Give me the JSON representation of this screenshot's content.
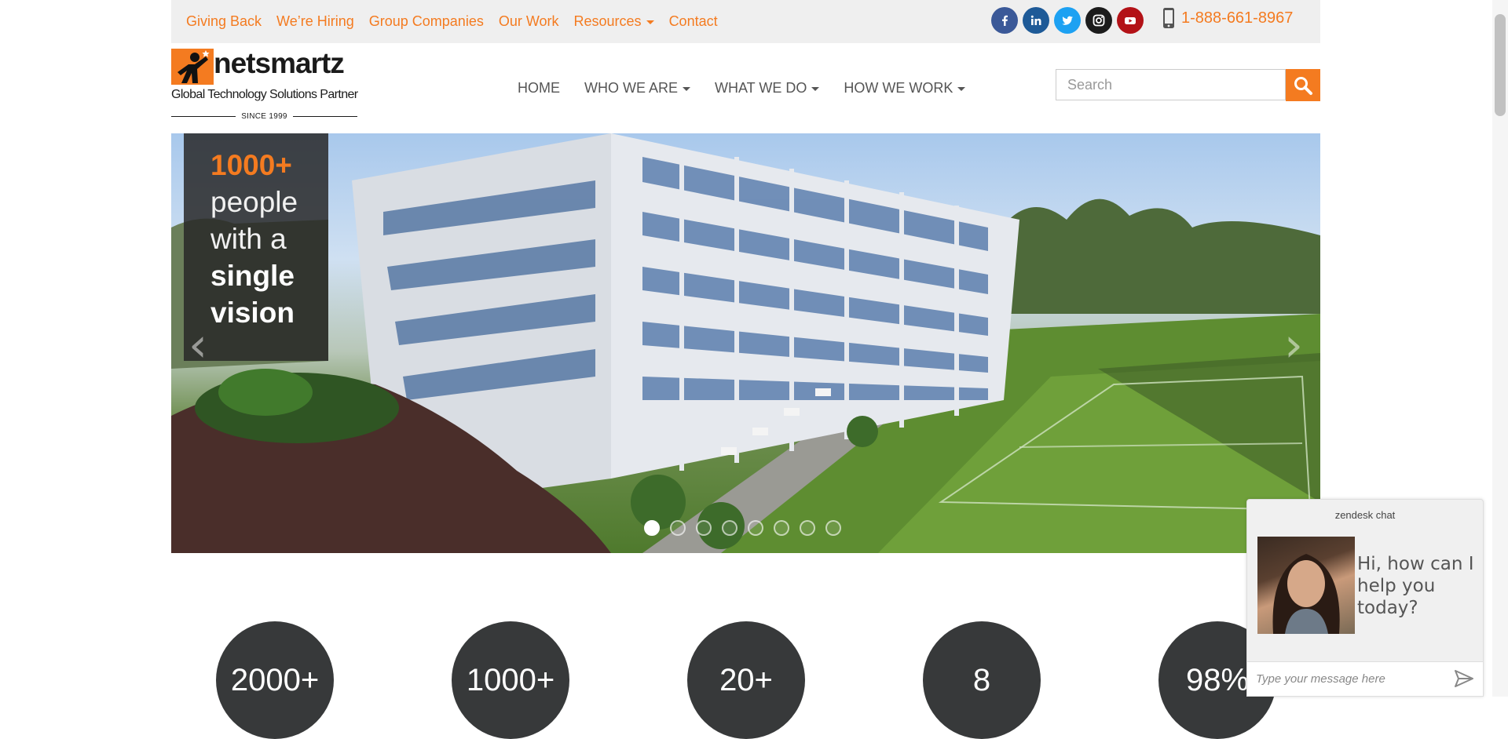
{
  "topbar": {
    "links": [
      {
        "label": "Giving Back"
      },
      {
        "label": "We’re Hiring"
      },
      {
        "label": "Group Companies"
      },
      {
        "label": "Our Work"
      },
      {
        "label": "Resources"
      },
      {
        "label": "Contact"
      }
    ],
    "socials": [
      {
        "name": "facebook",
        "color": "#3b5998"
      },
      {
        "name": "linkedin",
        "color": "#1e5a97"
      },
      {
        "name": "twitter",
        "color": "#1da1f2"
      },
      {
        "name": "instagram",
        "color": "#1c1c1c"
      },
      {
        "name": "youtube",
        "color": "#b31217"
      }
    ],
    "phone": "1-888-661-8967"
  },
  "logo": {
    "word": "netsmartz",
    "tagline": "Global Technology Solutions Partner",
    "since": "SINCE 1999"
  },
  "nav": {
    "home": "HOME",
    "who": "WHO WE ARE",
    "what": "WHAT WE DO",
    "how": "HOW WE WORK"
  },
  "search": {
    "placeholder": "Search"
  },
  "hero": {
    "num": "1000+",
    "line1": "people",
    "line2": "with a",
    "bold1": "single",
    "bold2": "vision",
    "slide_count": 8,
    "active_slide": 1
  },
  "stats": [
    "2000+",
    "1000+",
    "20+",
    "8",
    "98%"
  ],
  "chat": {
    "title": "zendesk chat",
    "message": "Hi, how can I help you today?",
    "placeholder": "Type your message here"
  },
  "colors": {
    "accent": "#f47b20",
    "stat_bg": "#37393a"
  }
}
